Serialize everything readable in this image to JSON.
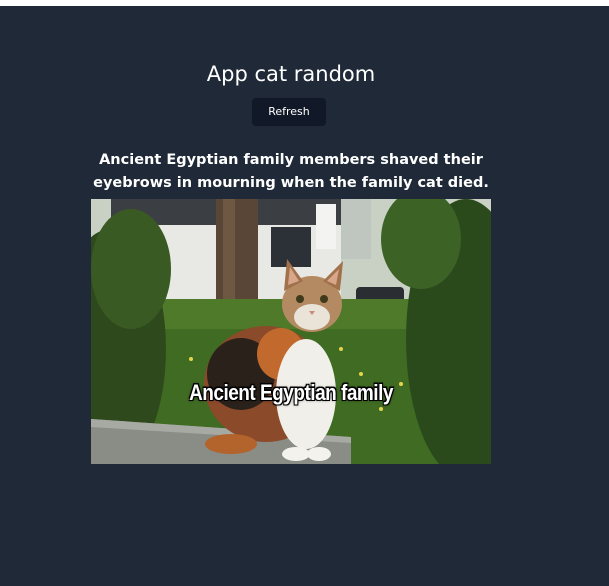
{
  "app": {
    "title": "App cat random",
    "refresh_label": "Refresh"
  },
  "fact": {
    "text": "Ancient Egyptian family members shaved their eyebrows in mourning when the family cat died."
  },
  "image": {
    "caption": "Ancient Egyptian family"
  },
  "colors": {
    "background": "#1f2937",
    "button": "#111827",
    "text": "#ffffff"
  }
}
